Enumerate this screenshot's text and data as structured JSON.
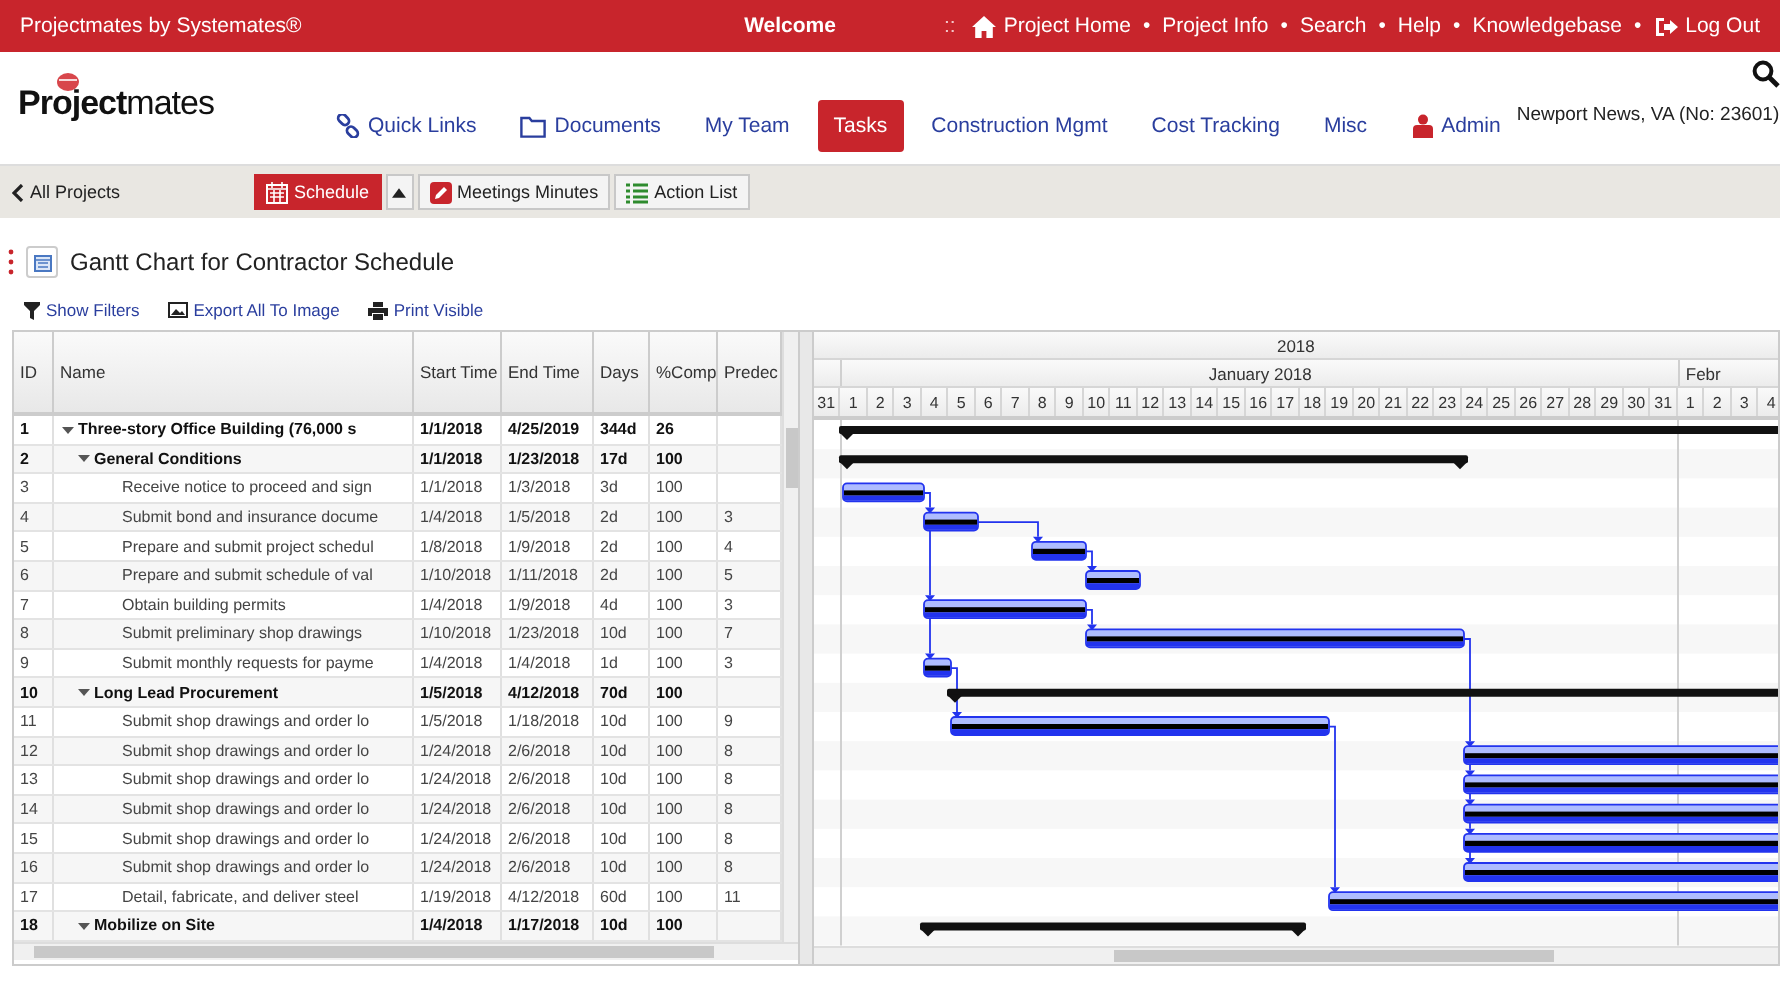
{
  "top_bar": {
    "brand": "Projectmates by Systemates®",
    "welcome": "Welcome",
    "separator": "::",
    "links": [
      {
        "kind": "home",
        "label": "Project Home"
      },
      {
        "kind": "dot",
        "label": "•"
      },
      {
        "kind": "link",
        "label": "Project Info"
      },
      {
        "kind": "dot",
        "label": "•"
      },
      {
        "kind": "link",
        "label": "Search"
      },
      {
        "kind": "dot",
        "label": "•"
      },
      {
        "kind": "link",
        "label": "Help"
      },
      {
        "kind": "dot",
        "label": "•"
      },
      {
        "kind": "link",
        "label": "Knowledgebase"
      },
      {
        "kind": "dot",
        "label": "•"
      },
      {
        "kind": "logout",
        "label": "Log Out"
      }
    ]
  },
  "logo": {
    "bold": "Project",
    "light": "mates"
  },
  "nav": [
    {
      "label": "Quick Links",
      "selected": false
    },
    {
      "label": "Documents",
      "selected": false
    },
    {
      "label": "My Team",
      "selected": false
    },
    {
      "label": "Tasks",
      "selected": true
    },
    {
      "label": "Construction Mgmt",
      "selected": false
    },
    {
      "label": "Cost Tracking",
      "selected": false
    },
    {
      "label": "Misc",
      "selected": false
    },
    {
      "label": "Admin",
      "selected": false
    }
  ],
  "location": "Newport News, VA (No: 23601)",
  "toolbar": {
    "back": "All Projects",
    "buttons": [
      {
        "label": "Schedule",
        "selected": true
      },
      {
        "label": "Meetings Minutes",
        "selected": false
      },
      {
        "label": "Action List",
        "selected": false
      }
    ]
  },
  "page_title": "Gantt Chart for Contractor Schedule",
  "actions": [
    "Show Filters",
    "Export All To Image",
    "Print Visible"
  ],
  "table": {
    "columns": [
      "ID",
      "Name",
      "Start Time",
      "End Time",
      "Days",
      "%Comp",
      "Predec"
    ],
    "rows": [
      {
        "id": "1",
        "name": "Three-story Office Building (76,000 s",
        "start": "1/1/2018",
        "end": "4/25/2019",
        "days": "344d",
        "comp": "26",
        "kind": "summary",
        "expanded": true,
        "children": [
          {
            "id": "2",
            "name": "General Conditions",
            "start": "1/1/2018",
            "end": "1/23/2018",
            "days": "17d",
            "comp": "100",
            "kind": "summary",
            "expanded": true,
            "children": [
              {
                "id": "3",
                "name": "Receive notice to proceed and sign",
                "start": "1/1/2018",
                "end": "1/3/2018",
                "days": "3d",
                "comp": "100",
                "kind": "task"
              },
              {
                "id": "4",
                "name": "Submit bond and insurance docume",
                "start": "1/4/2018",
                "end": "1/5/2018",
                "days": "2d",
                "comp": "100",
                "pred": "3",
                "kind": "task"
              },
              {
                "id": "5",
                "name": "Prepare and submit project schedul",
                "start": "1/8/2018",
                "end": "1/9/2018",
                "days": "2d",
                "comp": "100",
                "pred": "4",
                "kind": "task"
              },
              {
                "id": "6",
                "name": "Prepare and submit schedule of val",
                "start": "1/10/2018",
                "end": "1/11/2018",
                "days": "2d",
                "comp": "100",
                "pred": "5",
                "kind": "task"
              },
              {
                "id": "7",
                "name": "Obtain building permits",
                "start": "1/4/2018",
                "end": "1/9/2018",
                "days": "4d",
                "comp": "100",
                "pred": "3",
                "kind": "task"
              },
              {
                "id": "8",
                "name": "Submit preliminary shop drawings",
                "start": "1/10/2018",
                "end": "1/23/2018",
                "days": "10d",
                "comp": "100",
                "pred": "7",
                "kind": "task"
              },
              {
                "id": "9",
                "name": "Submit monthly requests for payme",
                "start": "1/4/2018",
                "end": "1/4/2018",
                "days": "1d",
                "comp": "100",
                "pred": "3",
                "kind": "task"
              }
            ]
          },
          {
            "id": "10",
            "name": "Long Lead Procurement",
            "start": "1/5/2018",
            "end": "4/12/2018",
            "days": "70d",
            "comp": "100",
            "kind": "summary",
            "expanded": true,
            "children": [
              {
                "id": "11",
                "name": "Submit shop drawings and order lo",
                "start": "1/5/2018",
                "end": "1/18/2018",
                "days": "10d",
                "comp": "100",
                "pred": "9",
                "kind": "task"
              },
              {
                "id": "12",
                "name": "Submit shop drawings and order lo",
                "start": "1/24/2018",
                "end": "2/6/2018",
                "days": "10d",
                "comp": "100",
                "pred": "8",
                "kind": "task"
              },
              {
                "id": "13",
                "name": "Submit shop drawings and order lo",
                "start": "1/24/2018",
                "end": "2/6/2018",
                "days": "10d",
                "comp": "100",
                "pred": "8",
                "kind": "task"
              },
              {
                "id": "14",
                "name": "Submit shop drawings and order lo",
                "start": "1/24/2018",
                "end": "2/6/2018",
                "days": "10d",
                "comp": "100",
                "pred": "8",
                "kind": "task"
              },
              {
                "id": "15",
                "name": "Submit shop drawings and order lo",
                "start": "1/24/2018",
                "end": "2/6/2018",
                "days": "10d",
                "comp": "100",
                "pred": "8",
                "kind": "task"
              },
              {
                "id": "16",
                "name": "Submit shop drawings and order lo",
                "start": "1/24/2018",
                "end": "2/6/2018",
                "days": "10d",
                "comp": "100",
                "pred": "8",
                "kind": "task"
              },
              {
                "id": "17",
                "name": "Detail, fabricate, and deliver steel",
                "start": "1/19/2018",
                "end": "4/12/2018",
                "days": "60d",
                "comp": "100",
                "pred": "11",
                "kind": "task"
              }
            ]
          },
          {
            "id": "18",
            "name": "Mobilize on Site",
            "start": "1/4/2018",
            "end": "1/17/2018",
            "days": "10d",
            "comp": "100",
            "kind": "summary",
            "expanded": true
          }
        ]
      }
    ]
  },
  "timeline": {
    "year": "2018",
    "months": [
      "January 2018",
      "Febr"
    ],
    "days": [
      "31",
      "1",
      "2",
      "3",
      "4",
      "5",
      "6",
      "7",
      "8",
      "9",
      "10",
      "11",
      "12",
      "13",
      "14",
      "15",
      "16",
      "17",
      "18",
      "19",
      "20",
      "21",
      "22",
      "23",
      "24",
      "25",
      "26",
      "27",
      "28",
      "29",
      "30",
      "31",
      "1",
      "2",
      "3",
      "4"
    ]
  }
}
